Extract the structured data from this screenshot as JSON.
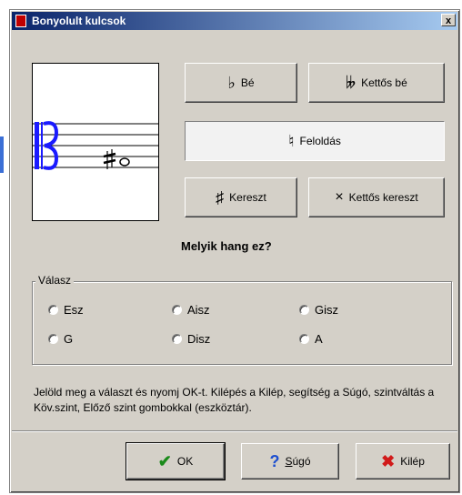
{
  "window": {
    "title": "Bonyolult kulcsok",
    "close_label": "x"
  },
  "accidentals": {
    "flat": {
      "glyph": "♭",
      "label": "Bé"
    },
    "double_flat": {
      "glyph": "𝄫",
      "label": "Kettős bé"
    },
    "natural": {
      "glyph": "♮",
      "label": "Feloldás"
    },
    "sharp": {
      "glyph": "♯",
      "label": "Kereszt"
    },
    "double_sharp": {
      "glyph": "×",
      "label": "Kettős kereszt"
    }
  },
  "question": "Melyik hang ez?",
  "answers": {
    "legend": "Válasz",
    "options": [
      "Esz",
      "Aisz",
      "Gisz",
      "G",
      "Disz",
      "A"
    ]
  },
  "instructions": "Jelöld meg a választ és nyomj OK-t. Kilépés a Kilép, segítség a Súgó, szintváltás a Köv.szint, Előző szint gombokkal (eszköztár).",
  "footer": {
    "ok": {
      "icon": "✔",
      "label": "OK"
    },
    "help": {
      "icon": "?",
      "label": "Súgó"
    },
    "exit": {
      "icon": "✖",
      "label": "Kilép"
    }
  },
  "colors": {
    "title_start": "#0a246a",
    "title_end": "#a6caf0",
    "clef": "#1a1aff",
    "ok_icon": "#1a8a1a",
    "help_icon": "#1d4fd0",
    "exit_icon": "#d11a1a"
  }
}
